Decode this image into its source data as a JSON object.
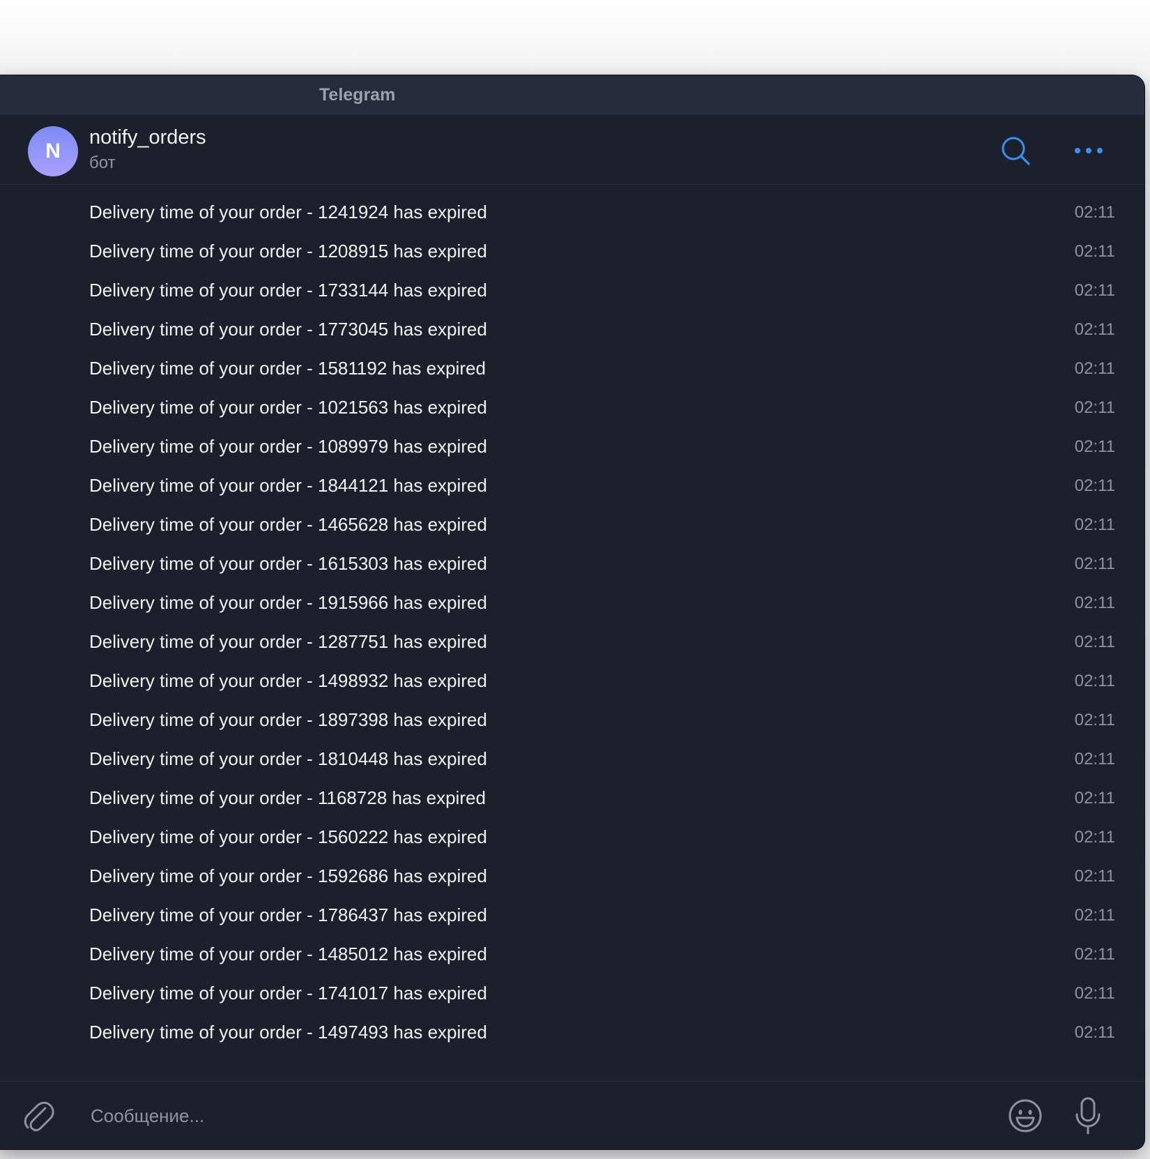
{
  "window": {
    "title": "Telegram"
  },
  "chat": {
    "avatar_letter": "N",
    "name": "notify_orders",
    "status": "бот"
  },
  "header_actions": {
    "search_icon": "search-icon",
    "more_icon": "more-horizontal-icon"
  },
  "messages": [
    {
      "text": "Delivery time of your order - 1241924 has expired",
      "time": "02:11"
    },
    {
      "text": "Delivery time of your order - 1208915 has expired",
      "time": "02:11"
    },
    {
      "text": "Delivery time of your order - 1733144 has expired",
      "time": "02:11"
    },
    {
      "text": "Delivery time of your order - 1773045 has expired",
      "time": "02:11"
    },
    {
      "text": "Delivery time of your order - 1581192 has expired",
      "time": "02:11"
    },
    {
      "text": "Delivery time of your order - 1021563 has expired",
      "time": "02:11"
    },
    {
      "text": "Delivery time of your order - 1089979 has expired",
      "time": "02:11"
    },
    {
      "text": "Delivery time of your order - 1844121 has expired",
      "time": "02:11"
    },
    {
      "text": "Delivery time of your order - 1465628 has expired",
      "time": "02:11"
    },
    {
      "text": "Delivery time of your order - 1615303 has expired",
      "time": "02:11"
    },
    {
      "text": "Delivery time of your order - 1915966 has expired",
      "time": "02:11"
    },
    {
      "text": "Delivery time of your order - 1287751 has expired",
      "time": "02:11"
    },
    {
      "text": "Delivery time of your order - 1498932 has expired",
      "time": "02:11"
    },
    {
      "text": "Delivery time of your order - 1897398 has expired",
      "time": "02:11"
    },
    {
      "text": "Delivery time of your order - 1810448 has expired",
      "time": "02:11"
    },
    {
      "text": "Delivery time of your order - 1168728 has expired",
      "time": "02:11"
    },
    {
      "text": "Delivery time of your order - 1560222 has expired",
      "time": "02:11"
    },
    {
      "text": "Delivery time of your order - 1592686 has expired",
      "time": "02:11"
    },
    {
      "text": "Delivery time of your order - 1786437 has expired",
      "time": "02:11"
    },
    {
      "text": "Delivery time of your order - 1485012 has expired",
      "time": "02:11"
    },
    {
      "text": "Delivery time of your order - 1741017 has expired",
      "time": "02:11"
    },
    {
      "text": "Delivery time of your order - 1497493 has expired",
      "time": "02:11"
    }
  ],
  "composer": {
    "placeholder": "Сообщение...",
    "value": "",
    "attach_icon": "paperclip-icon",
    "emoji_icon": "smiley-icon",
    "mic_icon": "microphone-icon"
  },
  "colors": {
    "window_bg": "#1b212c",
    "titlebar_bg": "#232d3b",
    "accent": "#3d8ef0",
    "text": "#f0f2f4",
    "muted": "#8a939e"
  }
}
